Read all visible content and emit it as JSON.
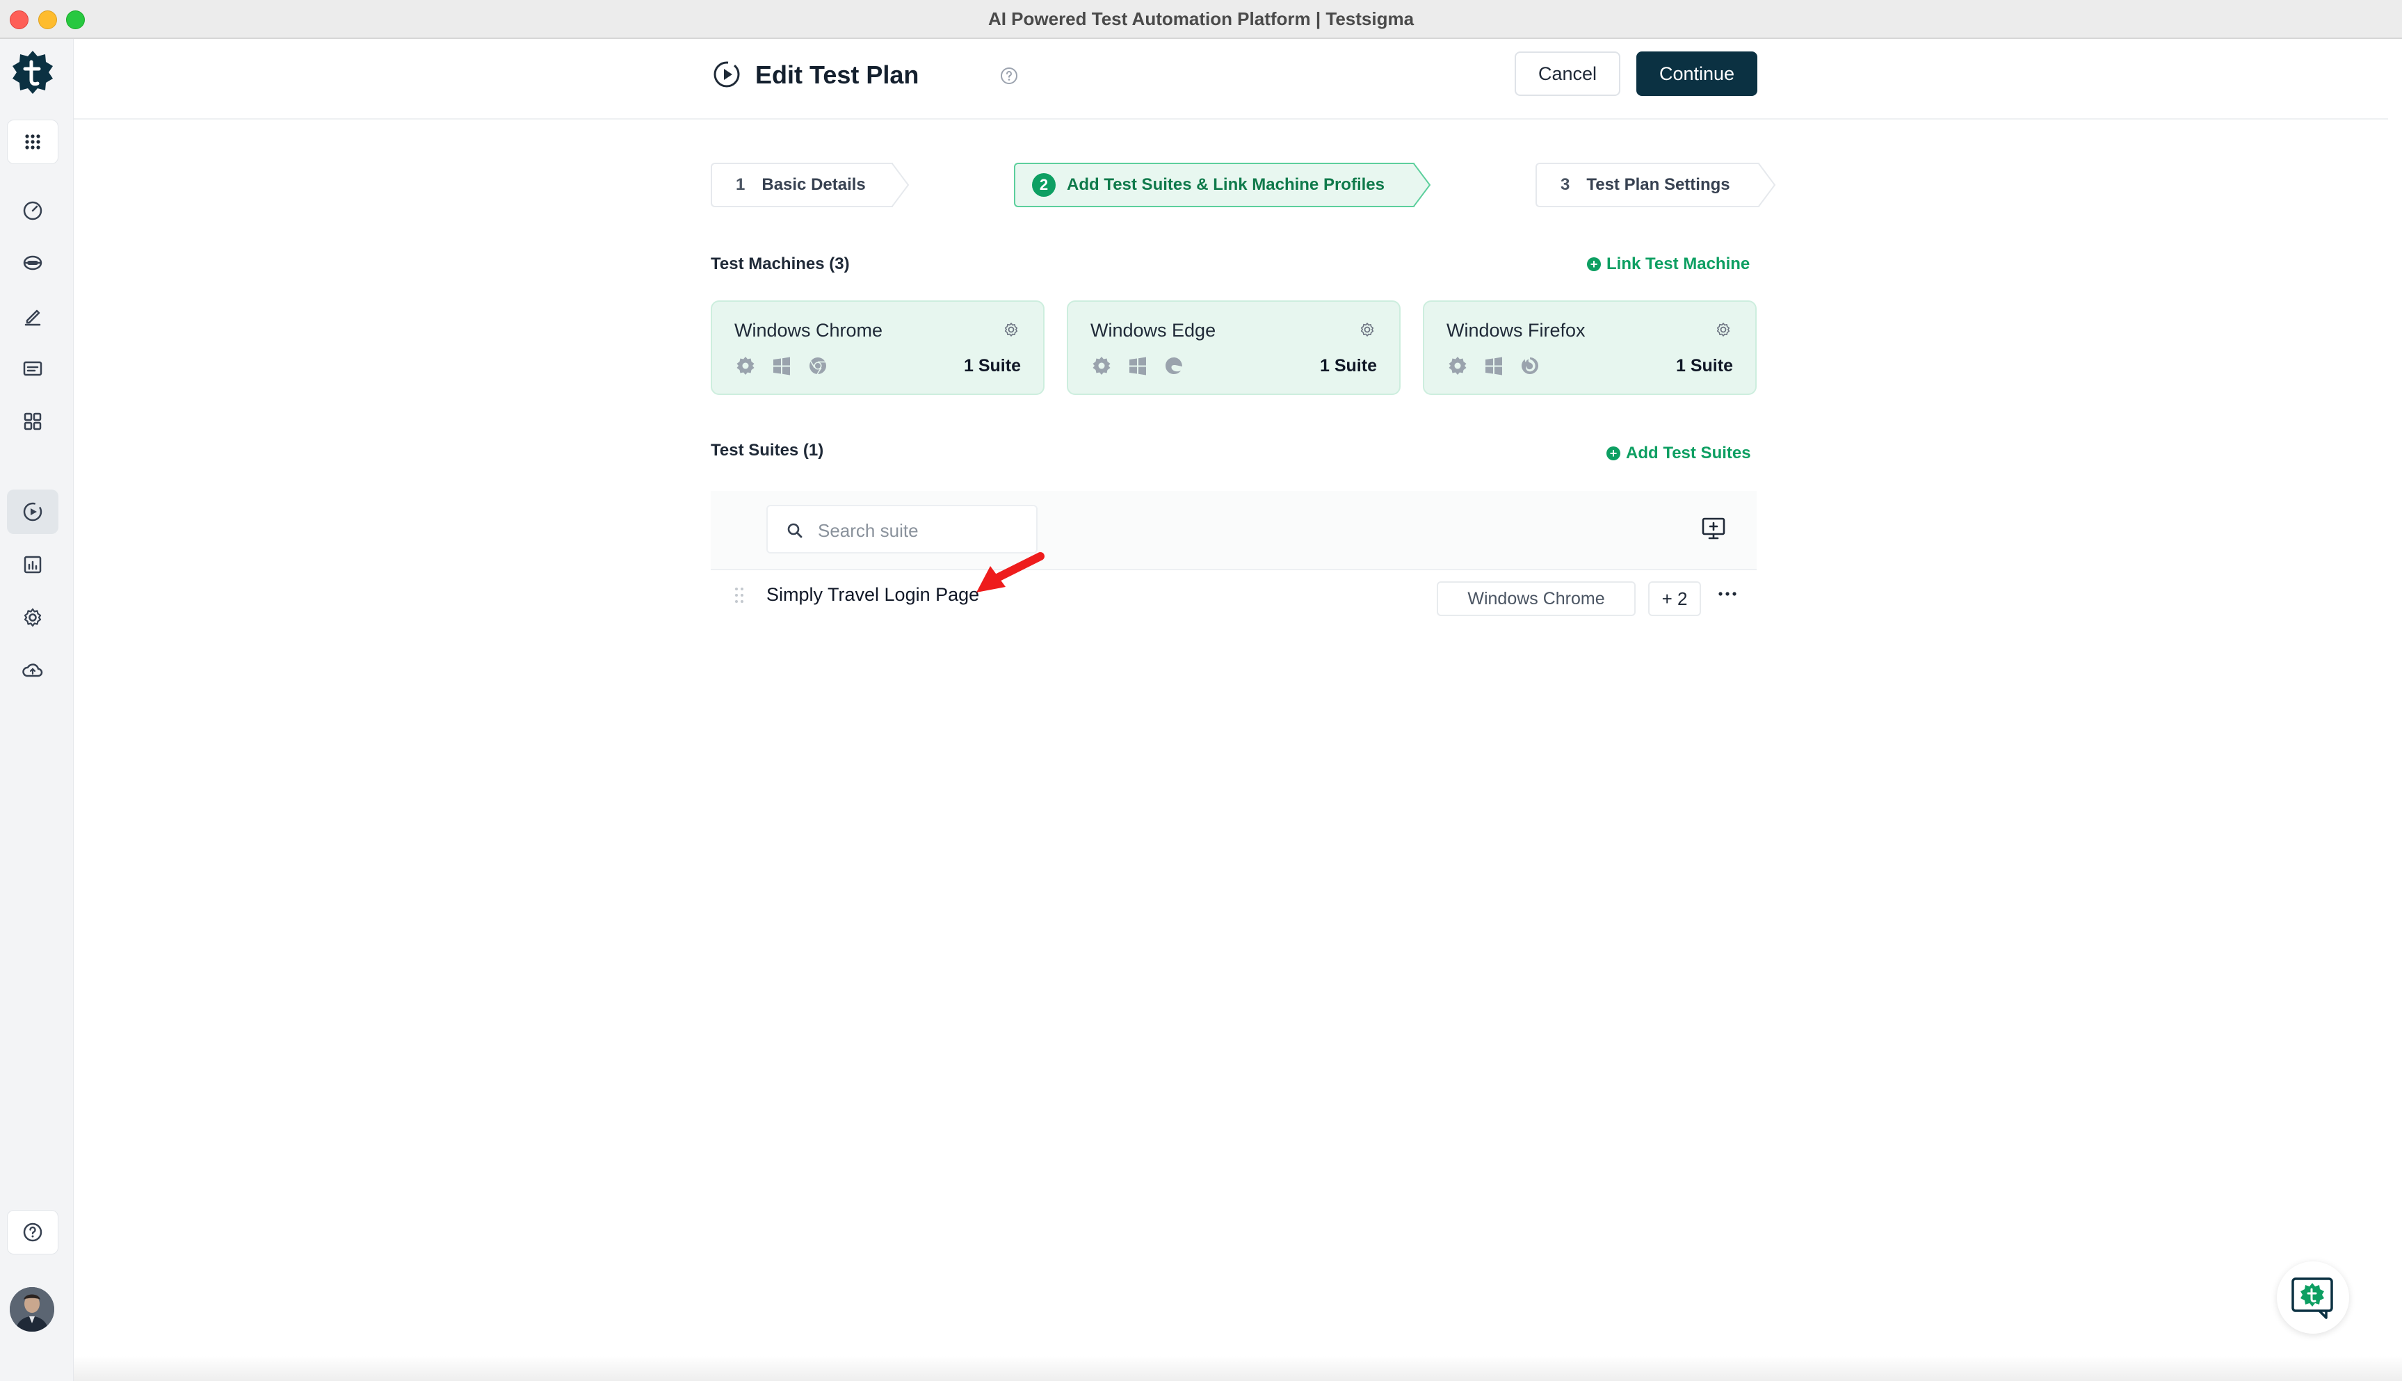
{
  "window": {
    "title": "AI Powered Test Automation Platform | Testsigma"
  },
  "sidebar": {
    "items": [
      {
        "name": "apps-grid",
        "icon": "grid-icon"
      },
      {
        "name": "dashboard",
        "icon": "speedometer-icon"
      },
      {
        "name": "test-data",
        "icon": "database-icon"
      },
      {
        "name": "test-cases",
        "icon": "pen-icon"
      },
      {
        "name": "test-suites",
        "icon": "folder-icon"
      },
      {
        "name": "elements",
        "icon": "blocks-icon"
      },
      {
        "name": "test-plans",
        "icon": "play-circle-icon",
        "active": true
      },
      {
        "name": "reports",
        "icon": "bar-chart-icon"
      },
      {
        "name": "settings",
        "icon": "gear-icon"
      },
      {
        "name": "cloud",
        "icon": "cloud-icon"
      },
      {
        "name": "help",
        "icon": "question-icon"
      }
    ]
  },
  "header": {
    "title": "Edit Test Plan",
    "cancel_label": "Cancel",
    "continue_label": "Continue"
  },
  "steps": [
    {
      "number": "1",
      "label": "Basic Details",
      "active": false
    },
    {
      "number": "2",
      "label": "Add Test Suites & Link Machine Profiles",
      "active": true
    },
    {
      "number": "3",
      "label": "Test Plan Settings",
      "active": false
    }
  ],
  "machines": {
    "title": "Test Machines (3)",
    "link_label": "Link Test Machine",
    "cards": [
      {
        "name": "Windows Chrome",
        "suite_count": "1 Suite",
        "browser_icon": "chrome-icon"
      },
      {
        "name": "Windows Edge",
        "suite_count": "1 Suite",
        "browser_icon": "edge-icon"
      },
      {
        "name": "Windows Firefox",
        "suite_count": "1 Suite",
        "browser_icon": "firefox-icon"
      }
    ]
  },
  "suites": {
    "title": "Test Suites (1)",
    "add_label": "Add Test Suites",
    "search_placeholder": "Search suite",
    "rows": [
      {
        "name": "Simply Travel Login Page",
        "machine": "Windows Chrome",
        "more": "+ 2"
      }
    ]
  },
  "colors": {
    "brand_dark": "#0b3142",
    "accent_green": "#0d9f62",
    "card_bg": "#e7f6ef",
    "annotation_red": "#ee1c1c"
  }
}
